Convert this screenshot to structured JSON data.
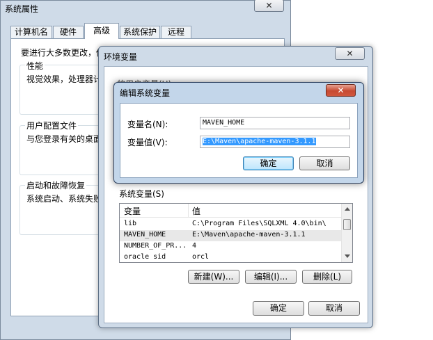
{
  "sysprops": {
    "title": "系统属性",
    "close": "✕",
    "tabs": [
      "计算机名",
      "硬件",
      "高级",
      "系统保护",
      "远程"
    ],
    "admin_note": "要进行大多数更改，你",
    "performance": {
      "title": "性能",
      "desc": "视觉效果，处理器计"
    },
    "user_profile": {
      "title": "用户配置文件",
      "desc": "与您登录有关的桌面"
    },
    "startup": {
      "title": "启动和故障恢复",
      "desc": "系统启动、系统失败"
    }
  },
  "envvars": {
    "title": "环境变量",
    "close": "✕",
    "user_vars_label": "的用户变量(U)",
    "system_vars_label": "系统变量(S)",
    "columns": [
      "变量",
      "值"
    ],
    "rows": [
      {
        "name": "lib",
        "value": "C:\\Program Files\\SQLXML 4.0\\bin\\"
      },
      {
        "name": "MAVEN_HOME",
        "value": "E:\\Maven\\apache-maven-3.1.1"
      },
      {
        "name": "NUMBER_OF_PR...",
        "value": "4"
      },
      {
        "name": "oracle sid",
        "value": "orcl"
      }
    ],
    "new_label": "新建(W)...",
    "edit_label": "编辑(I)...",
    "delete_label": "删除(L)",
    "ok_label": "确定",
    "cancel_label": "取消"
  },
  "editvar": {
    "title": "编辑系统变量",
    "close": "✕",
    "name_label": "变量名(N):",
    "name_value": "MAVEN_HOME",
    "value_label": "变量值(V):",
    "value_value": "E:\\Maven\\apache-maven-3.1.1",
    "ok_label": "确定",
    "cancel_label": "取消"
  },
  "colors": {
    "frame": "#cfdbe8",
    "selection": "#3399ff",
    "groupbox_border": "#d5dfe5"
  }
}
